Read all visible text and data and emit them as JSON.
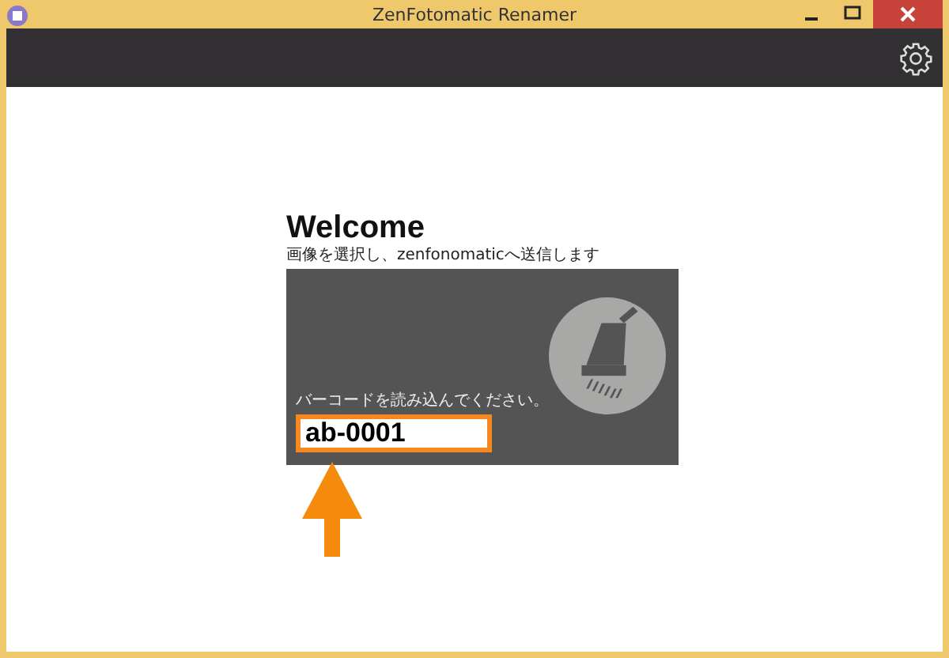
{
  "window": {
    "title": "ZenFotomatic Renamer"
  },
  "welcome": {
    "heading": "Welcome",
    "subtitle": "画像を選択し、zenfonomaticへ送信します"
  },
  "scan_panel": {
    "prompt": "バーコードを読み込んでください。",
    "barcode_field": {
      "value": "ab-0001"
    }
  }
}
